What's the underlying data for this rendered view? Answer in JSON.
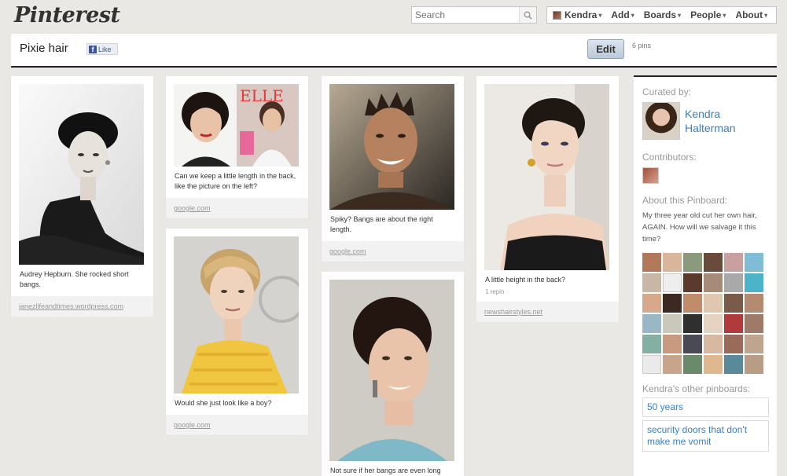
{
  "header": {
    "logo": "Pinterest",
    "search_placeholder": "Search",
    "nav": {
      "user": "Kendra",
      "add": "Add",
      "boards": "Boards",
      "people": "People",
      "about": "About"
    }
  },
  "board": {
    "title": "Pixie hair",
    "like_label": "Like",
    "edit_label": "Edit",
    "pin_count": "6 pins"
  },
  "pins": [
    {
      "desc": "Audrey Hepburn. She rocked short bangs.",
      "meta": "",
      "source": "janezlifeandtimes.wordpress.com"
    },
    {
      "desc": "Can we keep a little length in the back, like the picture on the left?",
      "meta": "",
      "source": "google.com"
    },
    {
      "desc": "Would she just look like a boy?",
      "meta": "",
      "source": "google.com"
    },
    {
      "desc": "Spiky? Bangs are about the right length.",
      "meta": "",
      "source": "google.com"
    },
    {
      "desc": "Not sure if her bangs are even long",
      "meta": "",
      "source": ""
    },
    {
      "desc": "A little height in the back?",
      "meta": "1 repin",
      "source": "newshairstyles.net"
    }
  ],
  "pin_art": {
    "elle_logo": "ELLE"
  },
  "sidebar": {
    "curated_by_label": "Curated by:",
    "curator_first": "Kendra",
    "curator_last": "Halterman",
    "contributors_label": "Contributors:",
    "about_label": "About this Pinboard:",
    "about_text": "My three year old cut her own hair, AGAIN. How will we salvage it this time?",
    "other_label": "Kendra's other pinboards:",
    "other_boards": [
      "50 years",
      "security doors that don't make me vomit"
    ]
  },
  "colors": {
    "background": "#e9e8e4",
    "link_blue": "#3a7fc2",
    "edit_button": "#c8d5e2"
  }
}
